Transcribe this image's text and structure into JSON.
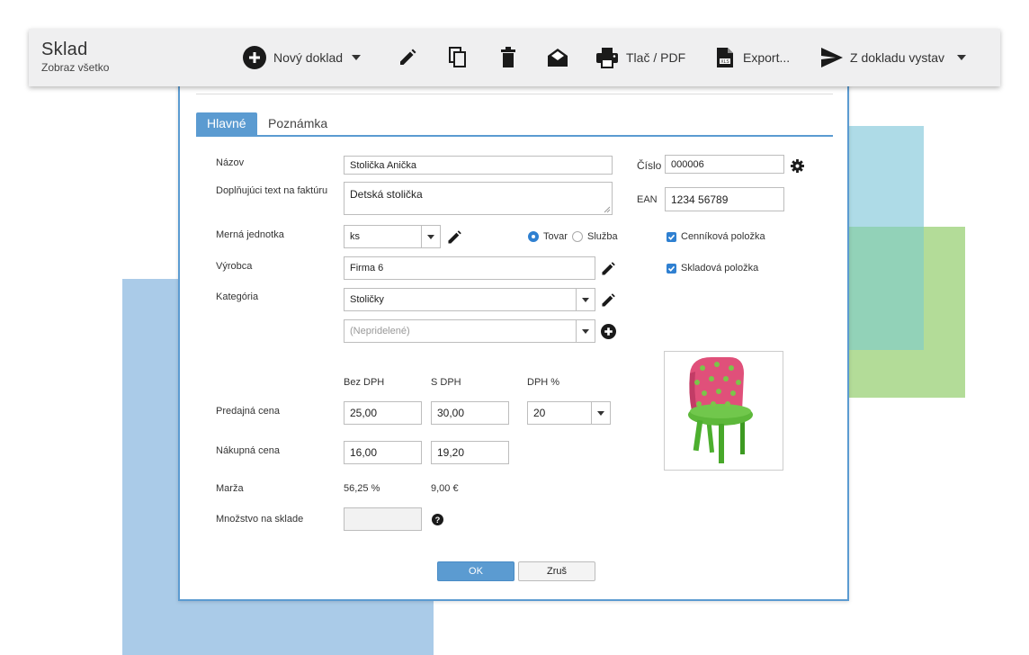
{
  "app": {
    "title": "Sklad",
    "subtitle": "Zobraz všetko"
  },
  "toolbar": {
    "new_doc": "Nový doklad",
    "print": "Tlač / PDF",
    "export": "Export...",
    "from_doc": "Z dokladu vystav",
    "icons": [
      "plus-circle-icon",
      "pencil-icon",
      "copy-icon",
      "trash-icon",
      "envelope-open-icon",
      "printer-icon",
      "xls-file-icon",
      "send-icon"
    ]
  },
  "tabs": [
    "Hlavné",
    "Poznámka"
  ],
  "form": {
    "name_label": "Názov",
    "name_value": "Stolička Anička",
    "extra_label": "Doplňujúci text na faktúru",
    "extra_value": "Detská stolička",
    "number_label": "Číslo",
    "number_value": "000006",
    "ean_label": "EAN",
    "ean_value": "1234 56789",
    "unit_label": "Merná jednotka",
    "unit_value": "ks",
    "type_goods": "Tovar",
    "type_service": "Služba",
    "type_selected": "Tovar",
    "pricelist_item": "Cenníková položka",
    "stock_item": "Skladová položka",
    "maker_label": "Výrobca",
    "maker_value": "Firma 6",
    "category_label": "Kategória",
    "category_value": "Stoličky",
    "subcategory_placeholder": "(Nepridelené)",
    "col_net": "Bez DPH",
    "col_gross": "S DPH",
    "col_vat": "DPH %",
    "sale_label": "Predajná cena",
    "sale_net": "25,00",
    "sale_gross": "30,00",
    "vat_value": "20",
    "purchase_label": "Nákupná cena",
    "purchase_net": "16,00",
    "purchase_gross": "19,20",
    "margin_label": "Marža",
    "margin_pct": "56,25 %",
    "margin_amount": "9,00 €",
    "stock_qty_label": "Množstvo na sklade",
    "stock_qty_value": ""
  },
  "buttons": {
    "ok": "OK",
    "cancel": "Zruš"
  },
  "colors": {
    "accent": "#5b9bd1",
    "check": "#2f80d1",
    "chair_pink": "#e0507a",
    "chair_green": "#4caf2e"
  }
}
